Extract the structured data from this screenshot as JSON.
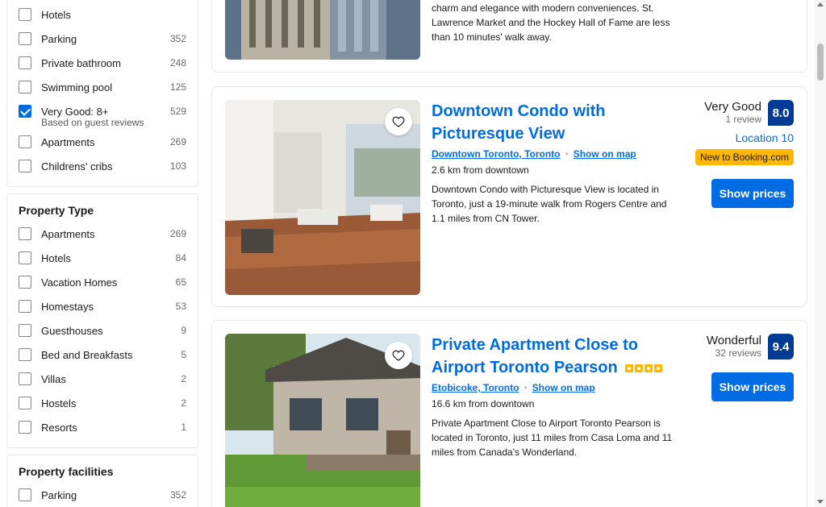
{
  "filters_top": {
    "items": [
      {
        "label": "Hotels",
        "count": "",
        "checked": false
      },
      {
        "label": "Parking",
        "count": "352",
        "checked": false
      },
      {
        "label": "Private bathroom",
        "count": "248",
        "checked": false
      },
      {
        "label": "Swimming pool",
        "count": "125",
        "checked": false
      },
      {
        "label": "Very Good: 8+",
        "count": "529",
        "checked": true
      },
      {
        "label": "Apartments",
        "count": "269",
        "checked": false
      },
      {
        "label": "Childrens' cribs",
        "count": "103",
        "checked": false
      }
    ],
    "note": "Based on guest reviews"
  },
  "property_type": {
    "title": "Property Type",
    "items": [
      {
        "label": "Apartments",
        "count": "269"
      },
      {
        "label": "Hotels",
        "count": "84"
      },
      {
        "label": "Vacation Homes",
        "count": "65"
      },
      {
        "label": "Homestays",
        "count": "53"
      },
      {
        "label": "Guesthouses",
        "count": "9"
      },
      {
        "label": "Bed and Breakfasts",
        "count": "5"
      },
      {
        "label": "Villas",
        "count": "2"
      },
      {
        "label": "Hostels",
        "count": "2"
      },
      {
        "label": "Resorts",
        "count": "1"
      }
    ]
  },
  "property_facilities": {
    "title": "Property facilities",
    "items": [
      {
        "label": "Parking",
        "count": "352"
      }
    ]
  },
  "top_card": {
    "desc": "charm and elegance with modern conveniences. St. Lawrence Market and the Hockey Hall of Fame are less than 10 minutes' walk away."
  },
  "listings": [
    {
      "title": "Downtown Condo with Picturesque View",
      "location": "Downtown Toronto, Toronto",
      "map_link": "Show on map",
      "distance": "2.6 km from downtown",
      "description": "Downtown Condo with Picturesque View is located in Toronto, just a 19-minute walk from Rogers Centre and 1.1 miles from CN Tower.",
      "rating_word": "Very Good",
      "reviews": "1 review",
      "score": "8.0",
      "location_score": "Location 10",
      "badge": "New to Booking.com",
      "button": "Show prices"
    },
    {
      "title": "Private Apartment Close to Airport Toronto Pearson",
      "location": "Etobicoke, Toronto",
      "map_link": "Show on map",
      "distance": "16.6 km from downtown",
      "description": "Private Apartment Close to Airport Toronto Pearson is located in Toronto, just 11 miles from Casa Loma and 11 miles from Canada's Wonderland.",
      "rating_word": "Wonderful",
      "reviews": "32 reviews",
      "score": "9.4",
      "button": "Show prices",
      "stars": 4
    }
  ],
  "colors": {
    "accent": "#006ce4",
    "score_bg": "#003b95",
    "badge": "#ffb700"
  }
}
